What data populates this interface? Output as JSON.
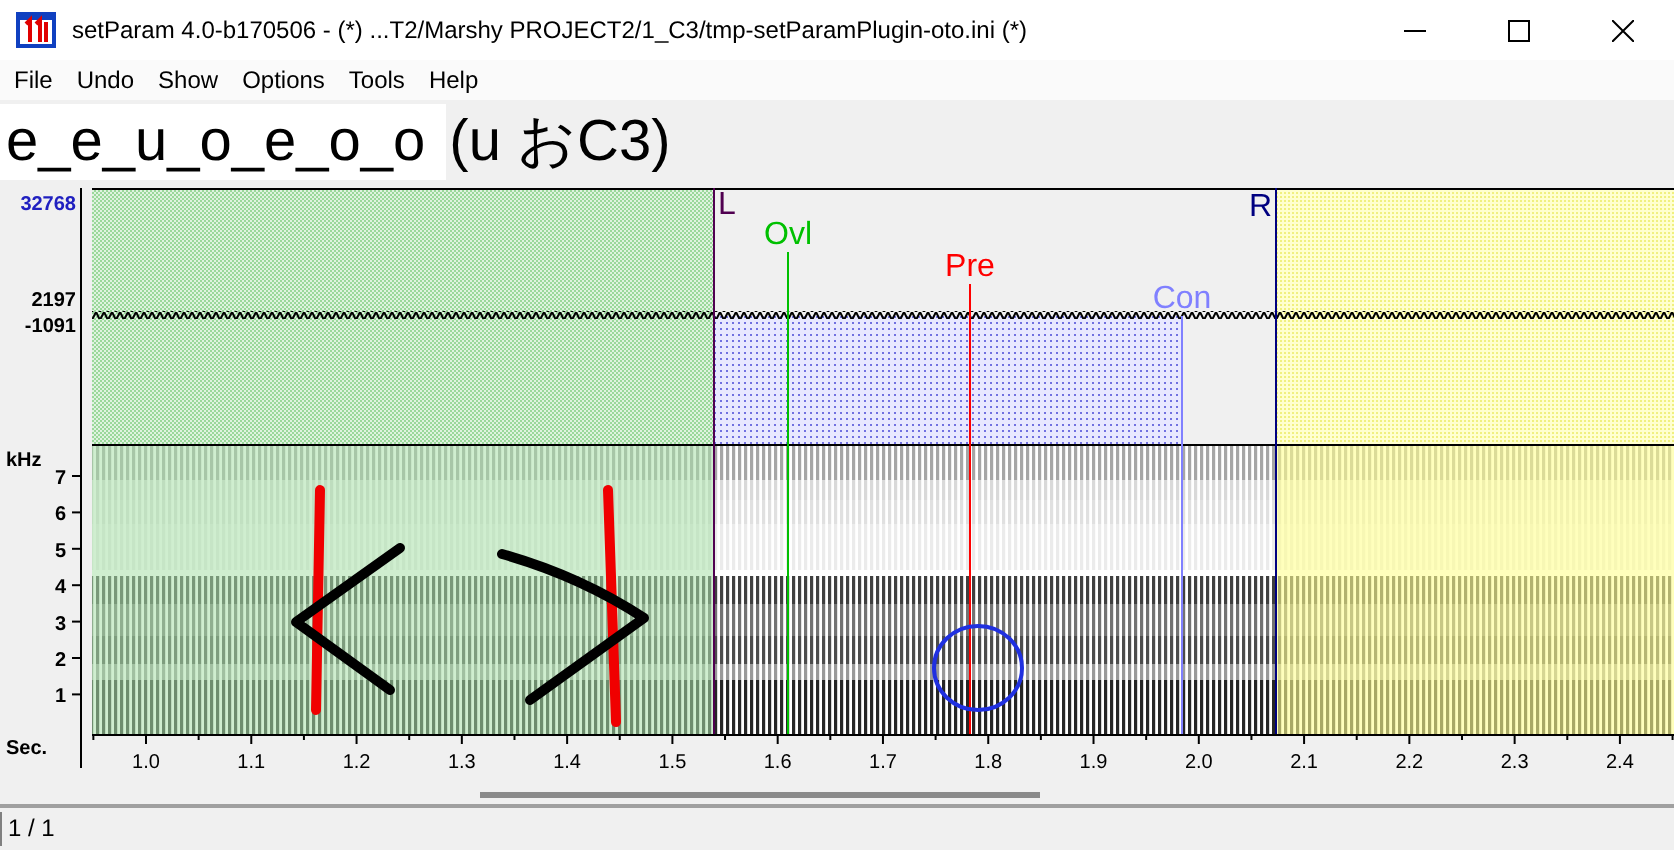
{
  "window": {
    "title": "setParam 4.0-b170506 - (*) ...T2/Marshy PROJECT2/1_C3/tmp-setParamPlugin-oto.ini (*)"
  },
  "menu": [
    "File",
    "Undo",
    "Show",
    "Options",
    "Tools",
    "Help"
  ],
  "alias": {
    "name": "e_e_u_o_e_o_o",
    "detail": "(u おC3)"
  },
  "waveform": {
    "axis_labels": [
      {
        "text": "32768",
        "color": "#2020c0"
      },
      {
        "text": "2197",
        "color": "#000000"
      },
      {
        "text": "-1091",
        "color": "#000000"
      }
    ]
  },
  "markers": [
    {
      "label": "L",
      "color": "#500050"
    },
    {
      "label": "Ovl",
      "color": "#00c000"
    },
    {
      "label": "Pre",
      "color": "#ff0000"
    },
    {
      "label": "Con",
      "color": "#8080ff"
    },
    {
      "label": "R",
      "color": "#000080"
    }
  ],
  "spectrogram": {
    "unit": "kHz",
    "ticks": [
      "7",
      "6",
      "5",
      "4",
      "3",
      "2",
      "1"
    ]
  },
  "time_axis": {
    "unit": "Sec.",
    "ticks": [
      "1.0",
      "1.1",
      "1.2",
      "1.3",
      "1.4",
      "1.5",
      "1.6",
      "1.7",
      "1.8",
      "1.9",
      "2.0",
      "2.1",
      "2.2",
      "2.3",
      "2.4"
    ]
  },
  "status_bar": "1 / 1"
}
